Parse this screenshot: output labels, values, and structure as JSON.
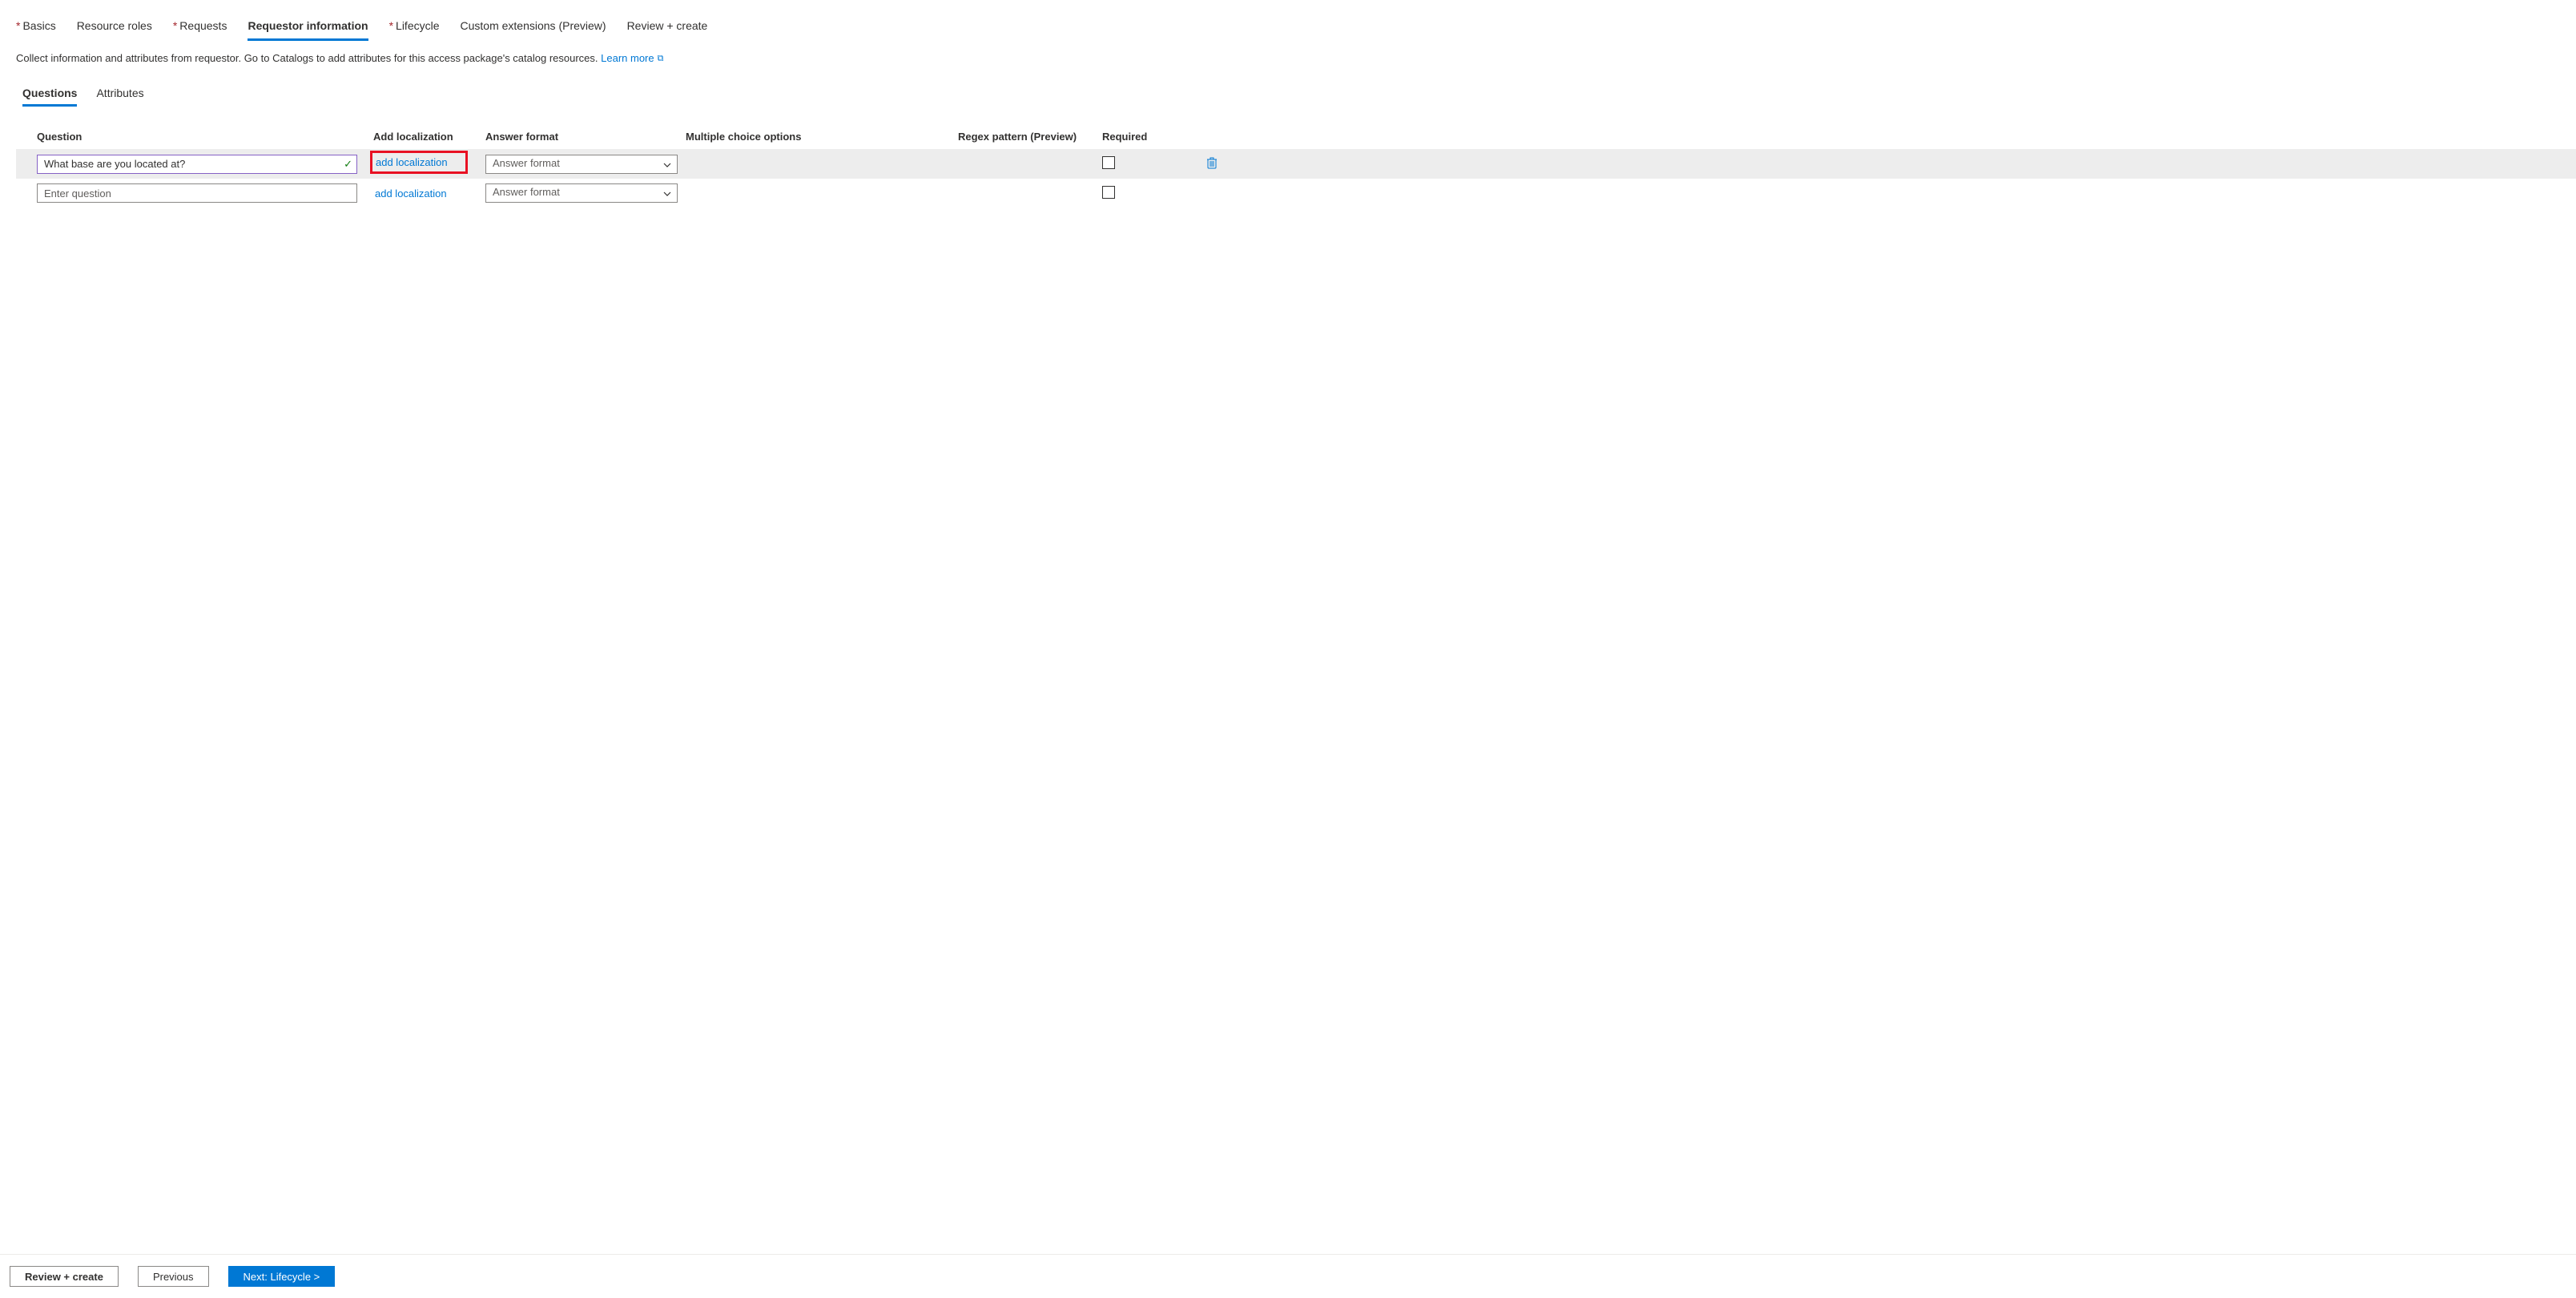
{
  "wizard": {
    "tabs": [
      {
        "label": "Basics",
        "required": true,
        "active": false
      },
      {
        "label": "Resource roles",
        "required": false,
        "active": false
      },
      {
        "label": "Requests",
        "required": true,
        "active": false
      },
      {
        "label": "Requestor information",
        "required": false,
        "active": true
      },
      {
        "label": "Lifecycle",
        "required": true,
        "active": false
      },
      {
        "label": "Custom extensions (Preview)",
        "required": false,
        "active": false
      },
      {
        "label": "Review + create",
        "required": false,
        "active": false
      }
    ]
  },
  "description": {
    "text": "Collect information and attributes from requestor. Go to Catalogs to add attributes for this access package's catalog resources. ",
    "link_label": "Learn more"
  },
  "subtabs": {
    "items": [
      {
        "label": "Questions",
        "active": true
      },
      {
        "label": "Attributes",
        "active": false
      }
    ]
  },
  "columns": {
    "question": "Question",
    "add_localization": "Add localization",
    "answer_format": "Answer format",
    "multiple_choice": "Multiple choice options",
    "regex": "Regex pattern (Preview)",
    "required": "Required"
  },
  "rows": [
    {
      "question_value": "What base are you located at?",
      "question_placeholder": "Enter question",
      "valid": true,
      "loc_link": "add localization",
      "loc_highlighted": true,
      "answer_format_placeholder": "Answer format",
      "required_checked": false,
      "deletable": true
    },
    {
      "question_value": "",
      "question_placeholder": "Enter question",
      "valid": false,
      "loc_link": "add localization",
      "loc_highlighted": false,
      "answer_format_placeholder": "Answer format",
      "required_checked": false,
      "deletable": false
    }
  ],
  "footer": {
    "review_label": "Review + create",
    "previous_label": "Previous",
    "next_label": "Next: Lifecycle >"
  }
}
